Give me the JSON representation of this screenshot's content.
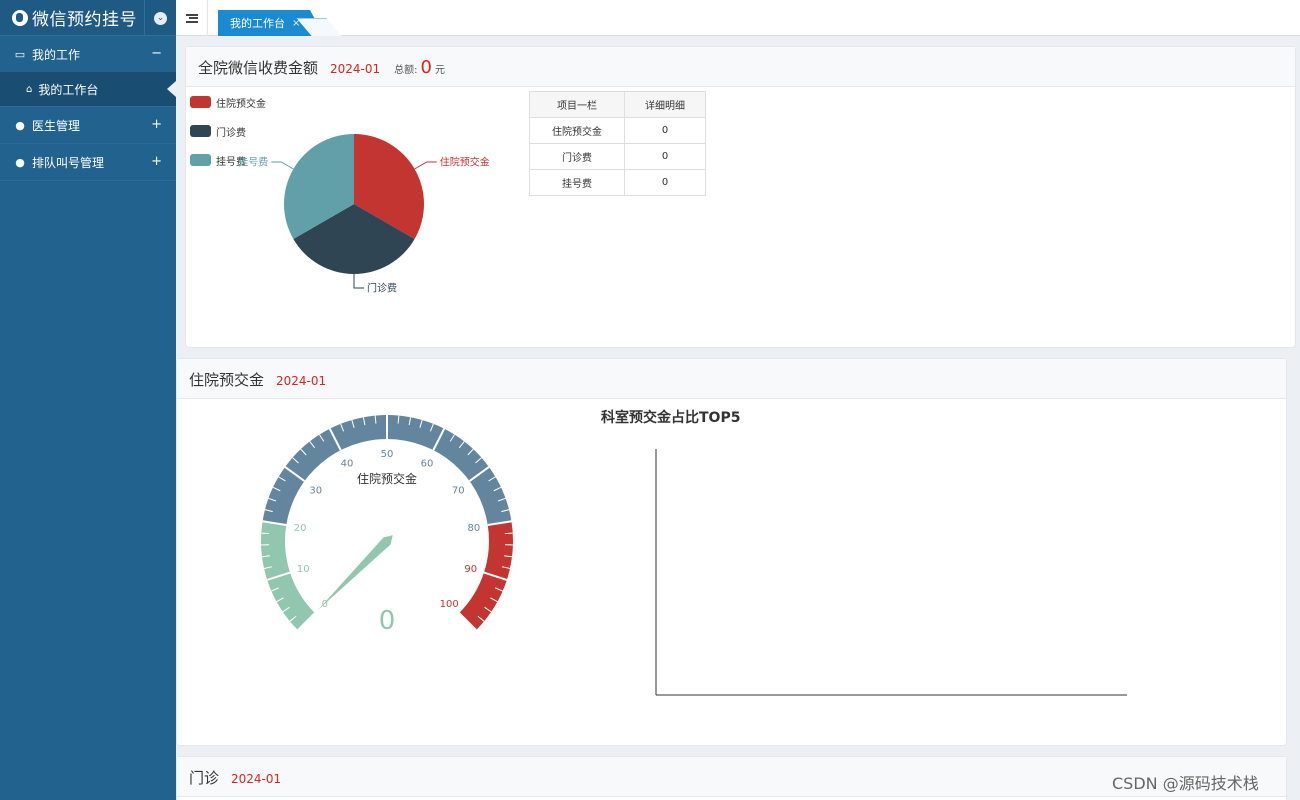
{
  "app": {
    "title": "微信预约挂号"
  },
  "sidebar": {
    "groups": [
      {
        "label": "我的工作",
        "sign": "−",
        "sub": [
          {
            "label": "我的工作台"
          }
        ]
      },
      {
        "label": "医生管理",
        "sign": "+"
      },
      {
        "label": "排队叫号管理",
        "sign": "+"
      }
    ]
  },
  "tabs": [
    {
      "label": "我的工作台",
      "close": "×"
    }
  ],
  "panel1": {
    "title": "全院微信收费金额",
    "date": "2024-01",
    "total_label": "总额:",
    "total_value": "0",
    "total_unit": "元",
    "table": {
      "headers": [
        "项目一栏",
        "详细明细"
      ],
      "rows": [
        [
          "住院预交金",
          "0"
        ],
        [
          "门诊费",
          "0"
        ],
        [
          "挂号费",
          "0"
        ]
      ]
    }
  },
  "panel2": {
    "title": "住院预交金",
    "date": "2024-01"
  },
  "panel3": {
    "title": "门诊",
    "date": "2024-01"
  },
  "colors": {
    "red": "#c23531",
    "dark": "#2f4554",
    "teal": "#61a0a8",
    "gauge_green": "#91c7ae",
    "gauge_blue": "#63869e",
    "sidebar": "#22628f",
    "tab": "#1a8bd1"
  },
  "watermark": "CSDN @源码技术栈",
  "chart_data": [
    {
      "type": "pie",
      "categories": [
        "住院预交金",
        "门诊费",
        "挂号费"
      ],
      "values": [
        0,
        0,
        0
      ],
      "series": [
        {
          "name": "住院预交金",
          "value": 0
        },
        {
          "name": "门诊费",
          "value": 0
        },
        {
          "name": "挂号费",
          "value": 0
        }
      ],
      "legend_placement": "top-left"
    },
    {
      "type": "gauge",
      "title": "住院预交金",
      "value": 0,
      "min": 0,
      "max": 100,
      "ticks": [
        0,
        10,
        20,
        30,
        40,
        50,
        60,
        70,
        80,
        90,
        100
      ],
      "bands": [
        {
          "to": 0.2,
          "color": "#91c7ae"
        },
        {
          "to": 0.8,
          "color": "#63869e"
        },
        {
          "to": 1.0,
          "color": "#c23531"
        }
      ]
    },
    {
      "type": "bar",
      "title": "科室预交金占比TOP5",
      "categories": [],
      "values": []
    }
  ]
}
